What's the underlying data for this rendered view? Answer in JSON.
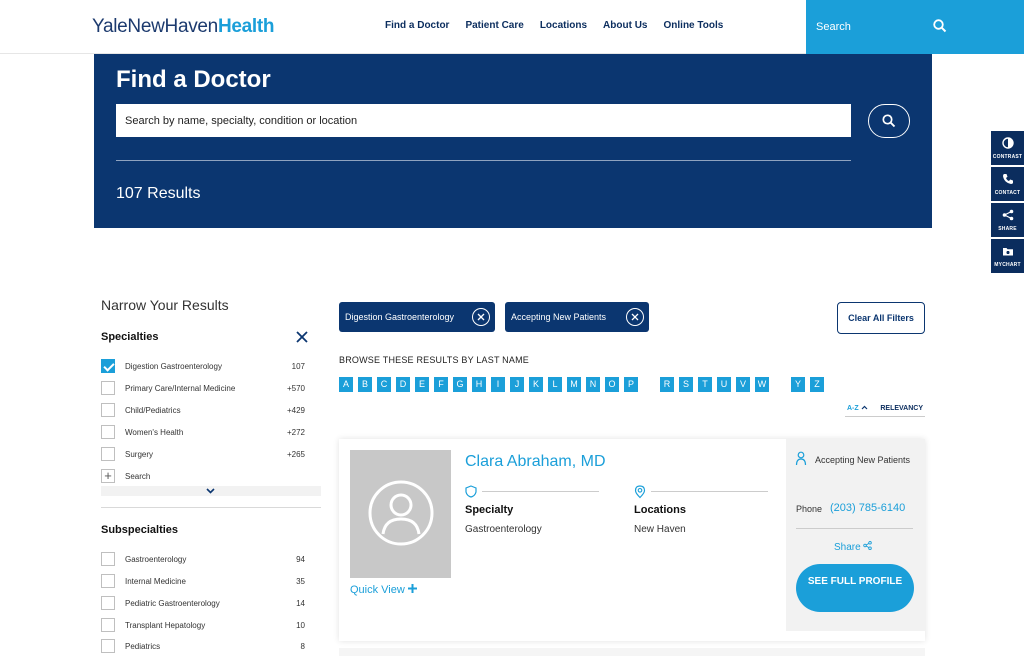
{
  "header": {
    "logo_part1": "YaleNewHaven",
    "logo_part2": "Health",
    "nav": [
      "Find a Doctor",
      "Patient Care",
      "Locations",
      "About Us",
      "Online Tools"
    ],
    "search_placeholder": "Search"
  },
  "hero": {
    "title": "Find a Doctor",
    "search_placeholder": "Search by name, specialty, condition or location",
    "results": "107 Results"
  },
  "side_tools": [
    {
      "label": "CONTRAST",
      "icon": "contrast-icon"
    },
    {
      "label": "CONTACT",
      "icon": "phone-icon"
    },
    {
      "label": "SHARE",
      "icon": "share-icon"
    },
    {
      "label": "MYCHART",
      "icon": "mychart-icon"
    }
  ],
  "filters": {
    "title": "Narrow Your Results",
    "specialties_heading": "Specialties",
    "specialties": [
      {
        "label": "Digestion Gastroenterology",
        "count": "107",
        "checked": true
      },
      {
        "label": "Primary Care/Internal Medicine",
        "count": "+570",
        "checked": false
      },
      {
        "label": "Child/Pediatrics",
        "count": "+429",
        "checked": false
      },
      {
        "label": "Women's Health",
        "count": "+272",
        "checked": false
      },
      {
        "label": "Surgery",
        "count": "+265",
        "checked": false
      }
    ],
    "search_label": "Search",
    "subspecialties_heading": "Subspecialties",
    "subspecialties": [
      {
        "label": "Gastroenterology",
        "count": "94"
      },
      {
        "label": "Internal Medicine",
        "count": "35"
      },
      {
        "label": "Pediatric Gastroenterology",
        "count": "14"
      },
      {
        "label": "Transplant Hepatology",
        "count": "10"
      },
      {
        "label": "Pediatrics",
        "count": "8"
      }
    ]
  },
  "active_filters": [
    "Digestion Gastroenterology",
    "Accepting New Patients"
  ],
  "clear_all": "Clear All Filters",
  "browse_label": "BROWSE THESE RESULTS BY LAST NAME",
  "letters": [
    "A",
    "B",
    "C",
    "D",
    "E",
    "F",
    "G",
    "H",
    "I",
    "J",
    "K",
    "L",
    "M",
    "N",
    "O",
    "P",
    "R",
    "S",
    "T",
    "U",
    "V",
    "W",
    "Y",
    "Z"
  ],
  "sort": {
    "az": "A-Z",
    "relevancy": "RELEVANCY"
  },
  "doctor": {
    "name": "Clara Abraham, MD",
    "quick_view": "Quick View",
    "specialty_label": "Specialty",
    "specialty": "Gastroenterology",
    "locations_label": "Locations",
    "location": "New Haven",
    "accepting": "Accepting New Patients",
    "phone_label": "Phone",
    "phone": "(203) 785-6140",
    "share": "Share",
    "profile_btn": "SEE FULL PROFILE"
  },
  "colors": {
    "navy": "#0b3670",
    "accent": "#1b9fd9"
  }
}
